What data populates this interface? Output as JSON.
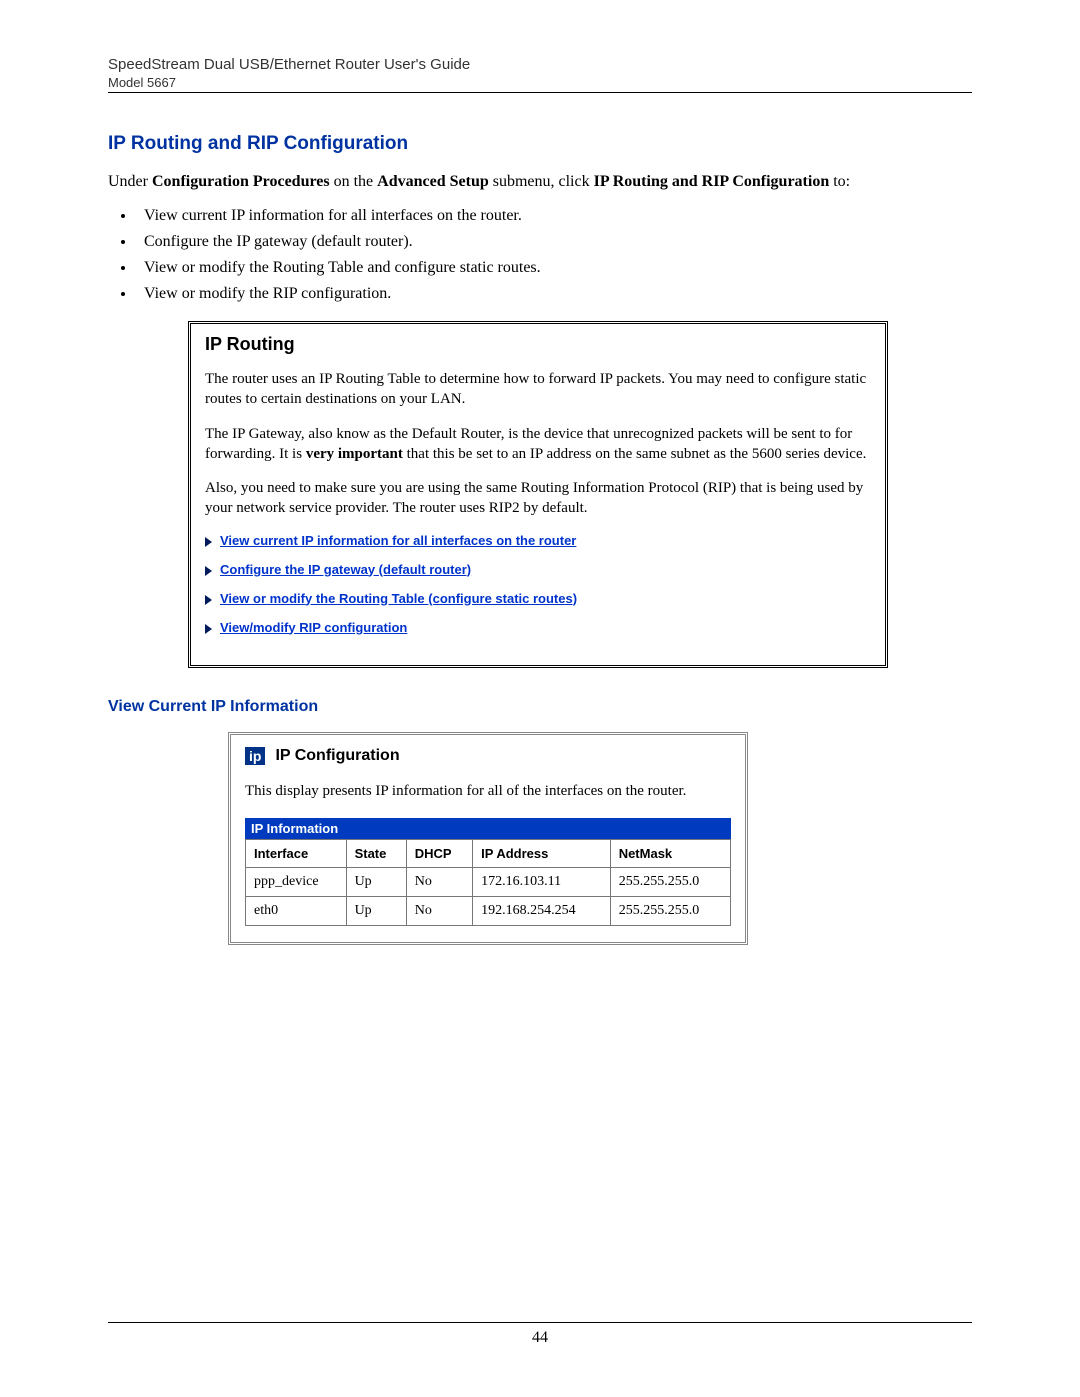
{
  "header": {
    "title": "SpeedStream Dual USB/Ethernet Router User's Guide",
    "model": "Model 5667"
  },
  "section_heading": "IP Routing and RIP Configuration",
  "intro": {
    "pre": "Under ",
    "bold1": "Configuration Procedures",
    "mid1": " on the ",
    "bold2": "Advanced Setup",
    "mid2": " submenu, click ",
    "bold3": "IP Routing and RIP Configuration",
    "post": " to:"
  },
  "bullets": [
    "View current IP information for all interfaces on the router.",
    "Configure the IP gateway (default router).",
    "View or modify the Routing Table and configure static routes.",
    "View or modify the RIP configuration."
  ],
  "panel": {
    "heading": "IP Routing",
    "p1": "The router uses an IP Routing Table to determine how to forward IP packets. You may need to configure static routes to certain destinations on your LAN.",
    "p2_pre": "The IP Gateway, also know as the Default Router, is the device that unrecognized packets will be sent to for forwarding. It is ",
    "p2_bold": "very important",
    "p2_post": " that this be set to an IP address on the same subnet as the 5600 series device.",
    "p3": "Also, you need to make sure you are using the same Routing Information Protocol (RIP) that is being used by your network service provider. The router uses RIP2 by default.",
    "links": [
      " View current IP information for all interfaces on the router",
      " Configure the IP gateway (default router)",
      " View or modify the Routing Table (configure static routes)",
      " View/modify RIP  configuration"
    ]
  },
  "subheading": "View Current IP Information",
  "config": {
    "badge": "ip",
    "title": "IP Configuration",
    "desc": "This display presents IP information for all of the interfaces on the router.",
    "table_title": "IP Information",
    "headers": [
      "Interface",
      "State",
      "DHCP",
      "IP Address",
      "NetMask"
    ],
    "rows": [
      [
        "ppp_device",
        "Up",
        "No",
        "172.16.103.11",
        "255.255.255.0"
      ],
      [
        "eth0",
        "Up",
        "No",
        "192.168.254.254",
        "255.255.255.0"
      ]
    ]
  },
  "page_number": "44"
}
